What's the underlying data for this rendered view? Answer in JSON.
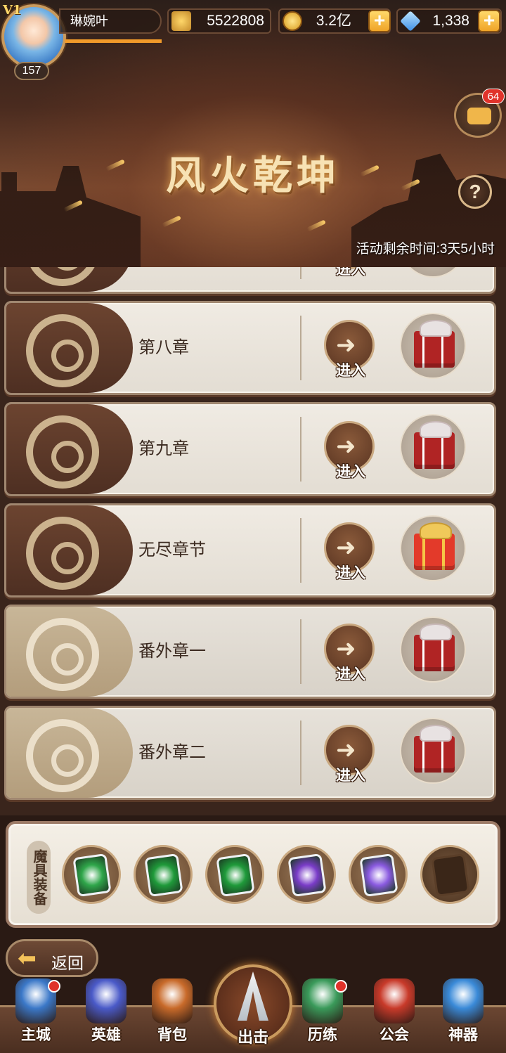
{
  "player": {
    "vip": "V1",
    "name": "琳婉叶",
    "level": "157",
    "exp_fraction": 1.0
  },
  "resources": {
    "power": "5522808",
    "gold": "3.2亿",
    "diamonds": "1,338"
  },
  "chat": {
    "unread": "64"
  },
  "banner": {
    "title": "风火乾坤",
    "countdown": "活动剩余时间:3天5小时"
  },
  "chapters": [
    {
      "name": "",
      "enter_label": "进入",
      "partial": true
    },
    {
      "name": "第八章",
      "enter_label": "进入"
    },
    {
      "name": "第九章",
      "enter_label": "进入"
    },
    {
      "name": "无尽章节",
      "enter_label": "进入"
    },
    {
      "name": "番外章一",
      "enter_label": "进入"
    },
    {
      "name": "番外章二",
      "enter_label": "进入"
    }
  ],
  "equipment": {
    "label": "魔具装备",
    "slots": [
      {
        "icon": "green-sword-card-icon",
        "color": "#2fa64a"
      },
      {
        "icon": "green-swirl-card-icon",
        "color": "#1f9a3a"
      },
      {
        "icon": "green-swirl-card-icon",
        "color": "#1f9a3a"
      },
      {
        "icon": "purple-swirl-card-icon",
        "color": "#7a3cc8"
      },
      {
        "icon": "purple-rune-card-icon",
        "color": "#8a5ae0"
      },
      {
        "icon": "empty-slot-icon",
        "color": ""
      }
    ]
  },
  "back_button": {
    "label": "返回"
  },
  "nav": {
    "items": [
      {
        "label": "主城",
        "icon": "castle-icon",
        "badge": true
      },
      {
        "label": "英雄",
        "icon": "hero-helmet-icon",
        "badge": false
      },
      {
        "label": "背包",
        "icon": "backpack-icon",
        "badge": false
      },
      {
        "label": "出击",
        "icon": "sword-attack-icon",
        "badge": false
      },
      {
        "label": "历练",
        "icon": "training-icon",
        "badge": true
      },
      {
        "label": "公会",
        "icon": "guild-icon",
        "badge": false
      },
      {
        "label": "神器",
        "icon": "artifact-icon",
        "badge": false
      }
    ]
  },
  "colors": {
    "accent_gold": "#f0a428",
    "badge_red": "#e0322a",
    "panel_brown": "#4e2f22"
  }
}
